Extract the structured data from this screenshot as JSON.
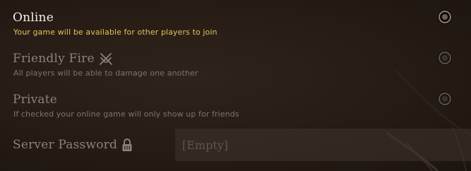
{
  "settings": {
    "online": {
      "title": "Online",
      "description": "Your game will be available for other players to join",
      "checked": true
    },
    "friendly_fire": {
      "title": "Friendly Fire",
      "description": "All players will be able to damage one another",
      "icon": "crossed-swords-icon",
      "checked": false
    },
    "private": {
      "title": "Private",
      "description": "If checked your online game will only show up for friends",
      "checked": false
    },
    "server_password": {
      "title": "Server Password",
      "icon": "lock-icon",
      "placeholder": "[Empty]",
      "value": ""
    }
  },
  "colors": {
    "background": "#261c15",
    "title_active": "#f4efe6",
    "title_inactive": "#8b8279",
    "description_active": "#e2c35a",
    "description_inactive": "#7d746b"
  }
}
